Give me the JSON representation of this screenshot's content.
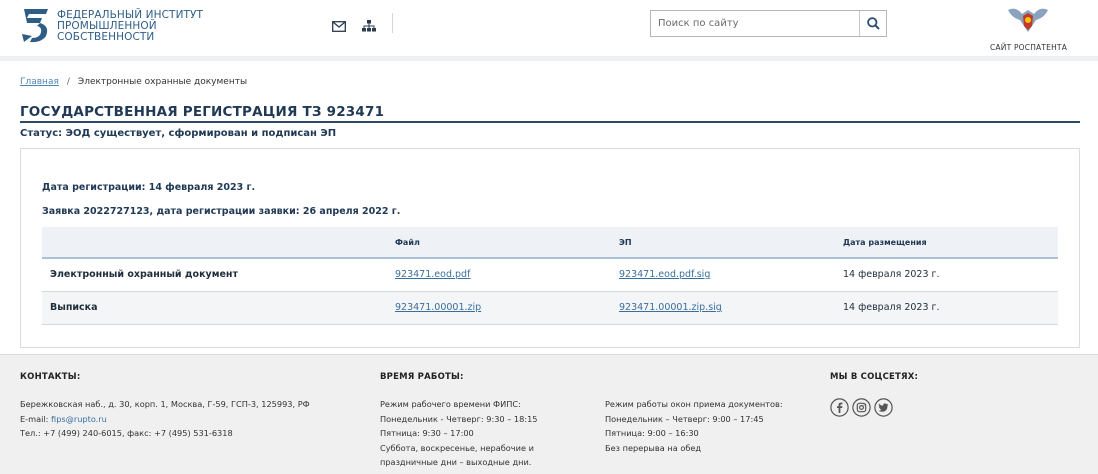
{
  "header": {
    "logo_text": "ФЕДЕРАЛЬНЫЙ ИНСТИТУТ ПРОМЫШЛЕННОЙ СОБСТВЕННОСТИ",
    "icons": [
      "mail-icon",
      "sitemap-icon"
    ],
    "search": {
      "placeholder": "Поиск по сайту",
      "value": "",
      "button_icon": "search-icon"
    },
    "rospatent_link": "САЙТ РОСПАТЕНТА"
  },
  "breadcrumb": {
    "home": "Главная",
    "separator": "/",
    "current": "Электронные охранные документы"
  },
  "page": {
    "title": "ГОСУДАРСТВЕННАЯ РЕГИСТРАЦИЯ ТЗ 923471",
    "status": "Статус: ЭОД существует, сформирован и подписан ЭП",
    "registration_date": "Дата регистрации: 14 февраля 2023 г.",
    "application": "Заявка 2022727123, дата регистрации заявки: 26 апреля 2022 г."
  },
  "table": {
    "headers": [
      "",
      "Файл",
      "ЭП",
      "Дата размещения"
    ],
    "rows": [
      {
        "name": "Электронный охранный документ",
        "file": "923471.eod.pdf",
        "signature": "923471.eod.pdf.sig",
        "date": "14 февраля 2023 г."
      },
      {
        "name": "Выписка",
        "file": "923471.00001.zip",
        "signature": "923471.00001.zip.sig",
        "date": "14 февраля 2023 г."
      }
    ]
  },
  "footer": {
    "contacts": {
      "heading": "КОНТАКТЫ:",
      "address": "Бережковская наб., д. 30, корп. 1, Москва, Г-59, ГСП-3, 125993, РФ",
      "email_label": "E-mail:",
      "email": "fips@rupto.ru",
      "phone": "Тел.: +7 (499) 240-6015, факс: +7 (495) 531-6318"
    },
    "hours": {
      "heading": "ВРЕМЯ РАБОТЫ:",
      "fips": [
        "Режим рабочего времени ФИПС:",
        "Понедельник - Четверг: 9:30 – 18:15",
        "Пятница: 9:30 – 17:00",
        "Суббота, воскресенье, нерабочие и",
        "праздничные дни – выходные дни."
      ],
      "windows": [
        "Режим работы окон приема документов:",
        "Понедельник – Четверг: 9:00 – 17:45",
        "Пятница: 9:00 – 16:30",
        "Без перерыва на обед"
      ]
    },
    "social": {
      "heading": "МЫ В СОЦСЕТЯХ:",
      "icons": [
        "facebook-icon",
        "instagram-icon",
        "twitter-icon"
      ]
    }
  },
  "colors": {
    "brand": "#2e5d86",
    "title": "#203a55",
    "link": "#3a6f9c",
    "table_header_bg": "#eef1f5"
  }
}
